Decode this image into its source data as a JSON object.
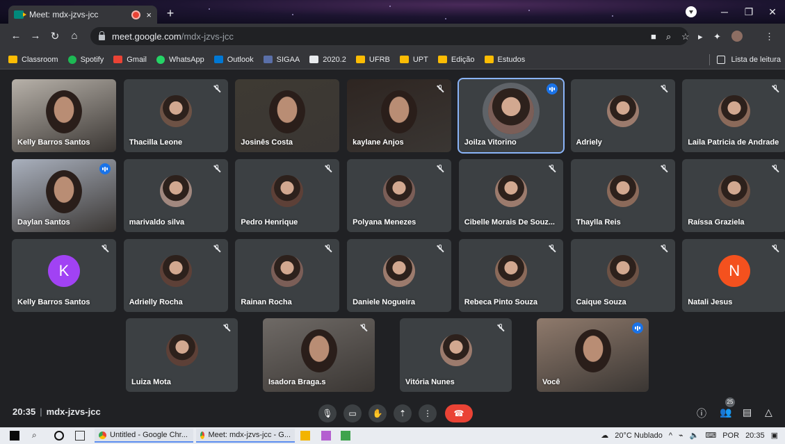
{
  "browser": {
    "tab_title": "Meet: mdx-jzvs-jcc",
    "tab_close": "×",
    "new_tab": "+",
    "url_host": "meet.google.com",
    "url_path": "/mdx-jzvs-jcc",
    "bookmarks": [
      {
        "label": "Classroom",
        "color": "#fbbc04"
      },
      {
        "label": "Spotify",
        "color": "#1db954"
      },
      {
        "label": "Gmail",
        "color": "#ea4335"
      },
      {
        "label": "WhatsApp",
        "color": "#25d366"
      },
      {
        "label": "Outlook",
        "color": "#0078d4"
      },
      {
        "label": "SIGAA",
        "color": "#5a6fa8"
      },
      {
        "label": "2020.2",
        "color": "#e8eaed"
      },
      {
        "label": "UFRB",
        "color": "#fbbc04"
      },
      {
        "label": "UPT",
        "color": "#fbbc04"
      },
      {
        "label": "Edição",
        "color": "#fbbc04"
      },
      {
        "label": "Estudos",
        "color": "#fbbc04"
      }
    ],
    "reading_list": "Lista de leitura"
  },
  "participants": [
    {
      "name": "Kelly Barros Santos",
      "kind": "video",
      "bg": "#b7b1a9"
    },
    {
      "name": "Thacilla Leone",
      "kind": "avatar",
      "muted": true
    },
    {
      "name": "Josinês Costa",
      "kind": "video",
      "bg": "#3e3a33"
    },
    {
      "name": "kaylane Anjos",
      "kind": "video",
      "bg": "#2e2521",
      "muted": true
    },
    {
      "name": "Joilza Vitorino",
      "kind": "avatar",
      "speaking": true
    },
    {
      "name": "Adriely",
      "kind": "avatar",
      "muted": true
    },
    {
      "name": "Laila Patricia de Andrade",
      "kind": "avatar",
      "muted": true
    },
    {
      "name": "Daylan Santos",
      "kind": "video",
      "bg": "#a9b0bd",
      "speaking": true
    },
    {
      "name": "marivaldo silva",
      "kind": "avatar",
      "muted": true
    },
    {
      "name": "Pedro Henrique",
      "kind": "avatar",
      "muted": true
    },
    {
      "name": "Polyana Menezes",
      "kind": "avatar",
      "muted": true
    },
    {
      "name": "Cibelle Morais De Souz...",
      "kind": "avatar",
      "muted": true
    },
    {
      "name": "Thaylla Reis",
      "kind": "avatar",
      "muted": true
    },
    {
      "name": "Raíssa Graziela",
      "kind": "avatar",
      "muted": true
    },
    {
      "name": "Kelly Barros Santos",
      "kind": "letter",
      "letter": "K",
      "color": "#a142f4",
      "muted": true
    },
    {
      "name": "Adrielly Rocha",
      "kind": "avatar",
      "muted": true
    },
    {
      "name": "Rainan Rocha",
      "kind": "avatar",
      "muted": true
    },
    {
      "name": "Daniele Nogueira",
      "kind": "avatar",
      "muted": true
    },
    {
      "name": "Rebeca Pinto Souza",
      "kind": "avatar",
      "muted": true
    },
    {
      "name": "Caique Souza",
      "kind": "avatar",
      "muted": true
    },
    {
      "name": "Natali Jesus",
      "kind": "letter",
      "letter": "N",
      "color": "#f4511e",
      "muted": true
    },
    {
      "name": "Luiza Mota",
      "kind": "avatar",
      "muted": true
    },
    {
      "name": "Isadora Braga.s",
      "kind": "video",
      "bg": "#6f6a66",
      "muted": true
    },
    {
      "name": "Vitória Nunes",
      "kind": "avatar",
      "muted": true
    },
    {
      "name": "Você",
      "kind": "video",
      "bg": "#8f7a6c",
      "speaking": true
    }
  ],
  "call": {
    "time": "20:35",
    "separator": "|",
    "meeting_code": "mdx-jzvs-jcc",
    "participant_count": "25"
  },
  "taskbar": {
    "apps": [
      "Untitled - Google Chr...",
      "Meet: mdx-jzvs-jcc - G..."
    ],
    "weather": "20°C  Nublado",
    "lang": "POR",
    "clock": "20:35"
  }
}
